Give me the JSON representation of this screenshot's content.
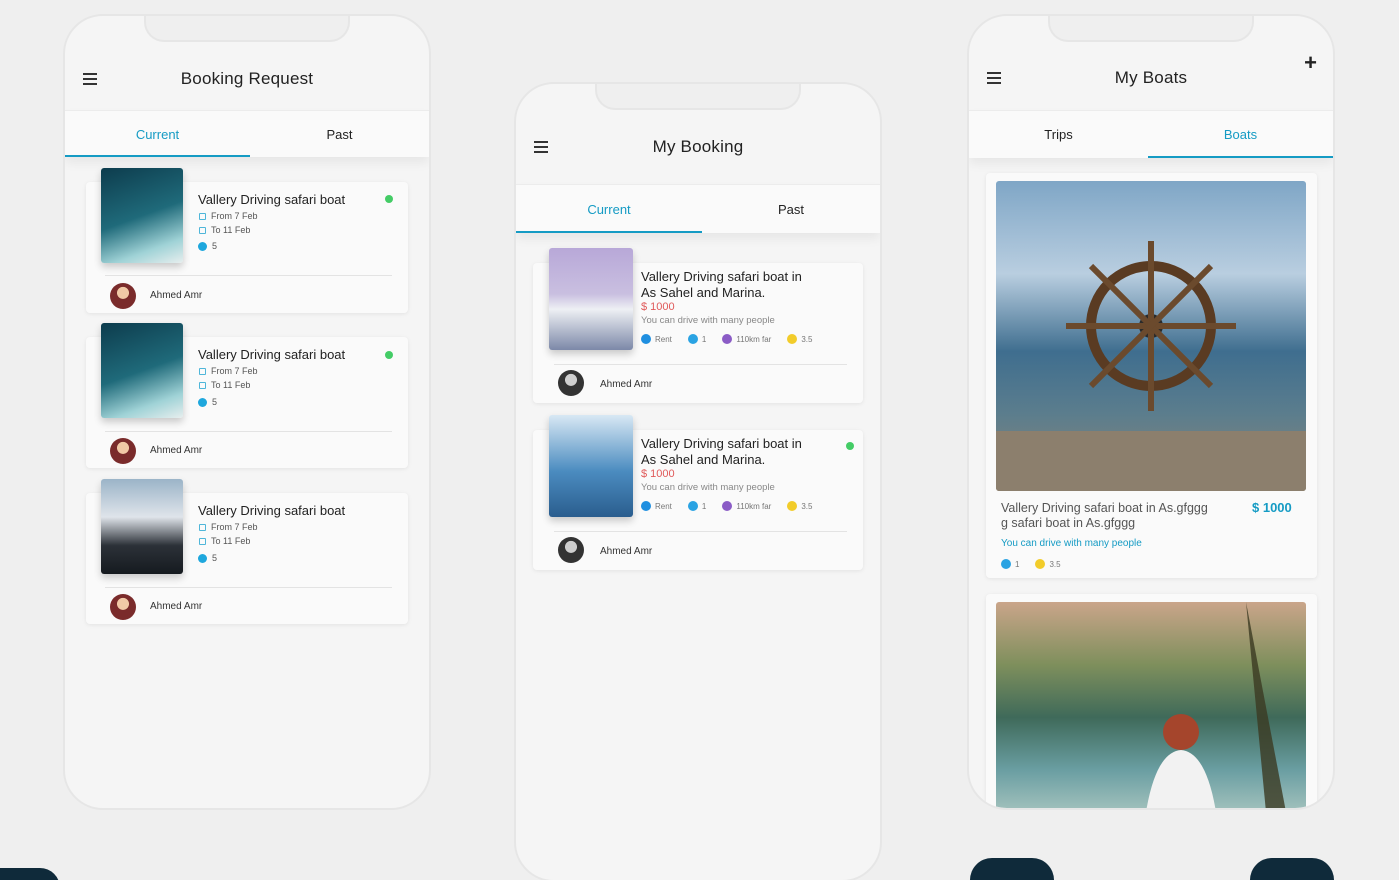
{
  "screens": {
    "booking_request": {
      "title": "Booking Request",
      "tabs": [
        {
          "label": "Current",
          "active": true
        },
        {
          "label": "Past",
          "active": false
        }
      ],
      "cards": [
        {
          "title": "Vallery Driving safari boat",
          "from": "From 7 Feb",
          "to": "To 11 Feb",
          "guests": "5",
          "user": "Ahmed Amr",
          "status": "online"
        },
        {
          "title": "Vallery Driving safari boat",
          "from": "From 7 Feb",
          "to": "To 11 Feb",
          "guests": "5",
          "user": "Ahmed Amr",
          "status": "online"
        },
        {
          "title": "Vallery Driving safari boat",
          "from": "From 7 Feb",
          "to": "To 11 Feb",
          "guests": "5",
          "user": "Ahmed Amr",
          "status": ""
        }
      ]
    },
    "my_booking": {
      "title": "My Booking",
      "tabs": [
        {
          "label": "Current",
          "active": true
        },
        {
          "label": "Past",
          "active": false
        }
      ],
      "cards": [
        {
          "title_line1": "Vallery Driving safari boat in",
          "title_line2": "As Sahel and Marina.",
          "price": "$ 1000",
          "desc": "You can drive with many people",
          "type": "Rent",
          "guests": "1",
          "distance": "110km far",
          "rating": "3.5",
          "user": "Ahmed Amr",
          "status": ""
        },
        {
          "title_line1": "Vallery Driving safari boat in",
          "title_line2": "As Sahel and Marina.",
          "price": "$ 1000",
          "desc": "You can drive with many people",
          "type": "Rent",
          "guests": "1",
          "distance": "110km far",
          "rating": "3.5",
          "user": "Ahmed Amr",
          "status": "online"
        }
      ]
    },
    "my_boats": {
      "title": "My Boats",
      "tabs": [
        {
          "label": "Trips",
          "active": false
        },
        {
          "label": "Boats",
          "active": true
        }
      ],
      "boats": [
        {
          "title_line1": "Vallery Driving safari boat in As.gfggg",
          "title_line2": "g safari boat in As.gfggg",
          "price": "$ 1000",
          "desc": "You can drive with many people",
          "guests": "1",
          "rating": "3.5"
        }
      ]
    }
  },
  "colors": {
    "accent": "#159bc4",
    "price_red": "#e05a5a",
    "status_green": "#44cc66"
  }
}
